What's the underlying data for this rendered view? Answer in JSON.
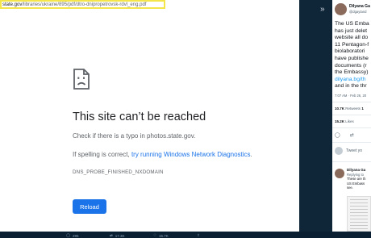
{
  "browser": {
    "url_host": "state.gov",
    "url_path": "/libraries/ukraine/895/pdf/dtro-dnipropetrovsk-rdvl_eng.pdf"
  },
  "error": {
    "title": "This site can’t be reached",
    "line1": "Check if there is a typo in photos.state.gov.",
    "line2_prefix": "If spelling is correct,",
    "line2_link": "try running Windows Network Diagnostics",
    "line2_suffix": ".",
    "code": "DNS_PROBE_FINISHED_NXDOMAIN",
    "reload_label": "Reload"
  },
  "bottom_bar": {
    "replies": "295",
    "retweets": "17.3K",
    "likes": "15.7K"
  },
  "tweet": {
    "author_name": "Dilyana Ga",
    "author_handle": "@dgaytand",
    "body_lines": [
      "The US Emba",
      "has just delet",
      "website all do",
      "11 Pentagon-f",
      "biolaboratori",
      "have publishe",
      "documents (r",
      "the Embassy)"
    ],
    "body_link": "dilyana.bg/th",
    "body_tail": "and in the thr",
    "meta": "7:07 AM · Feb 26, 20",
    "retweets_count": "10.7K",
    "retweets_label": "Retweets",
    "quote_count": "1",
    "likes_count": "15.2K",
    "likes_label": "Likes",
    "reply_placeholder": "Tweet yo",
    "reply_name": "Dilyana Ga",
    "reply_context": "Replying to",
    "reply_lines": [
      "These are th",
      "US Embass",
      "see."
    ]
  },
  "colors": {
    "link": "#1a73e8",
    "reload_button": "#1a73e8",
    "url_highlight": "#f4e64a",
    "dark_panel": "#0f2538"
  }
}
